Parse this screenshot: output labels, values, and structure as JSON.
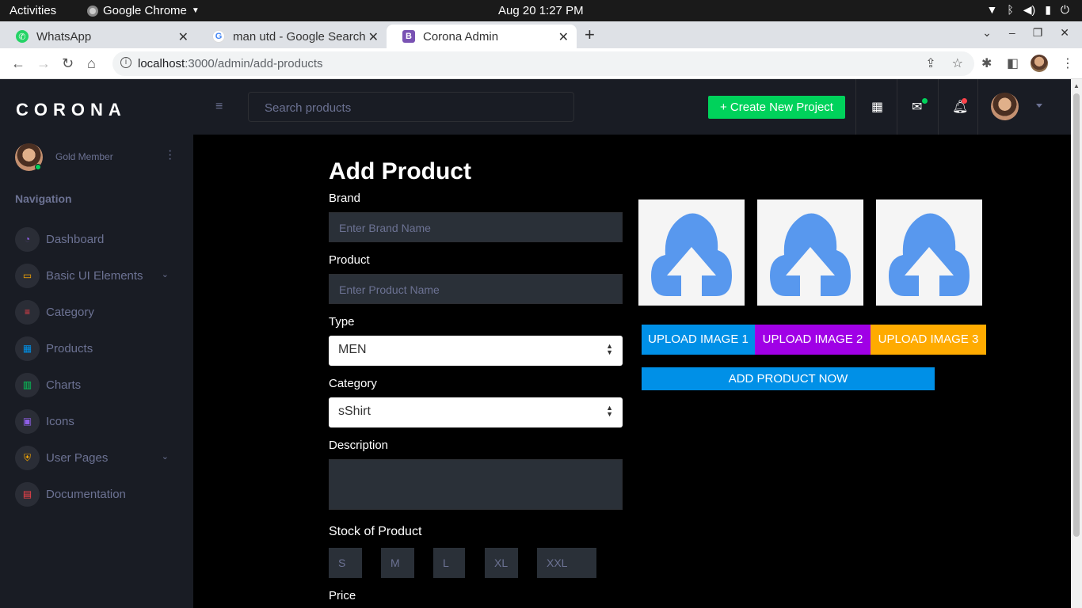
{
  "os": {
    "activities": "Activities",
    "app_name": "Google Chrome",
    "clock": "Aug 20  1:27 PM"
  },
  "browser": {
    "tabs": [
      {
        "title": "WhatsApp",
        "icon": "whatsapp-icon"
      },
      {
        "title": "man utd - Google Search",
        "icon": "google-icon"
      },
      {
        "title": "Corona Admin",
        "icon": "bootstrap-icon"
      }
    ],
    "url_host": "localhost",
    "url_path": ":3000/admin/add-products"
  },
  "sidebar": {
    "brand": "CORONA",
    "member": "Gold Member",
    "nav_header": "Navigation",
    "items": [
      {
        "label": "Dashboard",
        "icon": "speedometer-icon",
        "color": "#8f5fe8"
      },
      {
        "label": "Basic UI Elements",
        "icon": "laptop-icon",
        "color": "#ffab00"
      },
      {
        "label": "Category",
        "icon": "playlist-icon",
        "color": "#fc424a"
      },
      {
        "label": "Products",
        "icon": "table-icon",
        "color": "#0090e7"
      },
      {
        "label": "Charts",
        "icon": "chart-bar-icon",
        "color": "#00d25b"
      },
      {
        "label": "Icons",
        "icon": "contacts-icon",
        "color": "#8f5fe8"
      },
      {
        "label": "User Pages",
        "icon": "security-icon",
        "color": "#ffab00"
      },
      {
        "label": "Documentation",
        "icon": "file-document-icon",
        "color": "#fc424a"
      }
    ]
  },
  "header": {
    "search_placeholder": "Search products",
    "create_label": "+ Create New Project"
  },
  "form": {
    "title": "Add Product",
    "brand_label": "Brand",
    "brand_placeholder": "Enter Brand Name",
    "product_label": "Product",
    "product_placeholder": "Enter Product Name",
    "type_label": "Type",
    "type_value": "MEN",
    "category_label": "Category",
    "category_value": "sShirt",
    "description_label": "Description",
    "stock_label": "Stock of Product",
    "sizes": [
      "S",
      "M",
      "L",
      "XL",
      "XXL"
    ],
    "price_label": "Price"
  },
  "images": {
    "upload_buttons": [
      {
        "label": "UPLOAD IMAGE 1",
        "color": "#0090e7"
      },
      {
        "label": "UPLOAD IMAGE 2",
        "color": "#a000e6"
      },
      {
        "label": "UPLOAD IMAGE 3",
        "color": "#ffab00"
      }
    ],
    "add_label": "ADD PRODUCT NOW"
  },
  "colors": {
    "cloud": "#5898ee",
    "success": "#00d25b",
    "primary": "#0090e7"
  }
}
